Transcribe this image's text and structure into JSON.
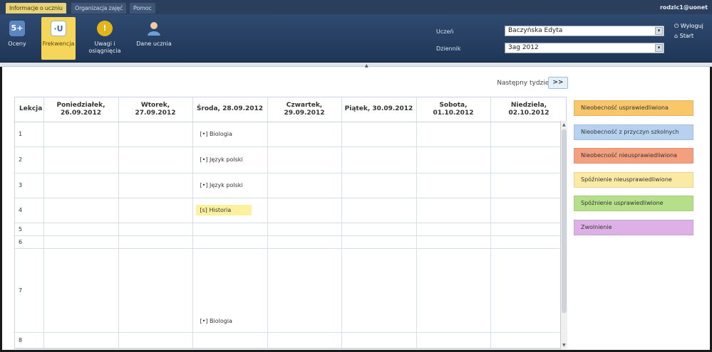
{
  "tabs": [
    {
      "label": "Informacje o uczniu",
      "active": true
    },
    {
      "label": "Organizacja zajęć",
      "active": false
    },
    {
      "label": "Pomoc",
      "active": false
    }
  ],
  "account": {
    "user": "rodzic1@uonet",
    "logout": "Wyloguj",
    "start": "Start"
  },
  "toolbar": {
    "buttons": [
      {
        "label": "Oceny",
        "icon": "5+"
      },
      {
        "label": "Frekwencja",
        "icon": "·U"
      },
      {
        "label": "Uwagi i osiągnięcia",
        "icon": "!"
      },
      {
        "label": "Dane ucznia",
        "icon": "person"
      }
    ],
    "student_label": "Uczeń",
    "student_value": "Baczyńska Edyta",
    "journal_label": "Dziennik",
    "journal_value": "3ag 2012"
  },
  "next_week": {
    "label": "Następny tydzień",
    "button": ">>"
  },
  "grid": {
    "headers": [
      "Lekcja",
      "Poniedziałek,\n26.09.2012",
      "Wtorek,\n27.09.2012",
      "Środa, 28.09.2012",
      "Czwartek,\n29.09.2012",
      "Piątek, 30.09.2012",
      "Sobota,\n01.10.2012",
      "Niedziela,\n02.10.2012"
    ],
    "rows": [
      {
        "num": "1",
        "wed": "[•] Biologia",
        "wed_style": "plain"
      },
      {
        "num": "2",
        "wed": "[•] Język polski",
        "wed_style": "plain"
      },
      {
        "num": "3",
        "wed": "[•] Język polski",
        "wed_style": "plain"
      },
      {
        "num": "4",
        "wed": "[s] Historia",
        "wed_style": "yellow"
      },
      {
        "num": "5",
        "wed": "",
        "wed_style": "plain"
      },
      {
        "num": "6",
        "wed": "",
        "wed_style": "plain"
      },
      {
        "num": "7",
        "wed": "[•] Biologia",
        "wed_style": "plain"
      },
      {
        "num": "8",
        "wed": "",
        "wed_style": "plain"
      }
    ]
  },
  "legend": [
    {
      "label": "Nieobecność usprawiedliwiona",
      "color": "#f9c66a"
    },
    {
      "label": "Nieobecność z przyczyn szkolnych",
      "color": "#b6d2f0"
    },
    {
      "label": "Nieobecność nieusprawiedliwiona",
      "color": "#f4a07e"
    },
    {
      "label": "Spóźnienie nieusprawiedliwione",
      "color": "#fbeaa3"
    },
    {
      "label": "Spóźnienie usprawiedliwione",
      "color": "#b6df8a"
    },
    {
      "label": "Zwolnienie",
      "color": "#ddb1e6"
    }
  ]
}
